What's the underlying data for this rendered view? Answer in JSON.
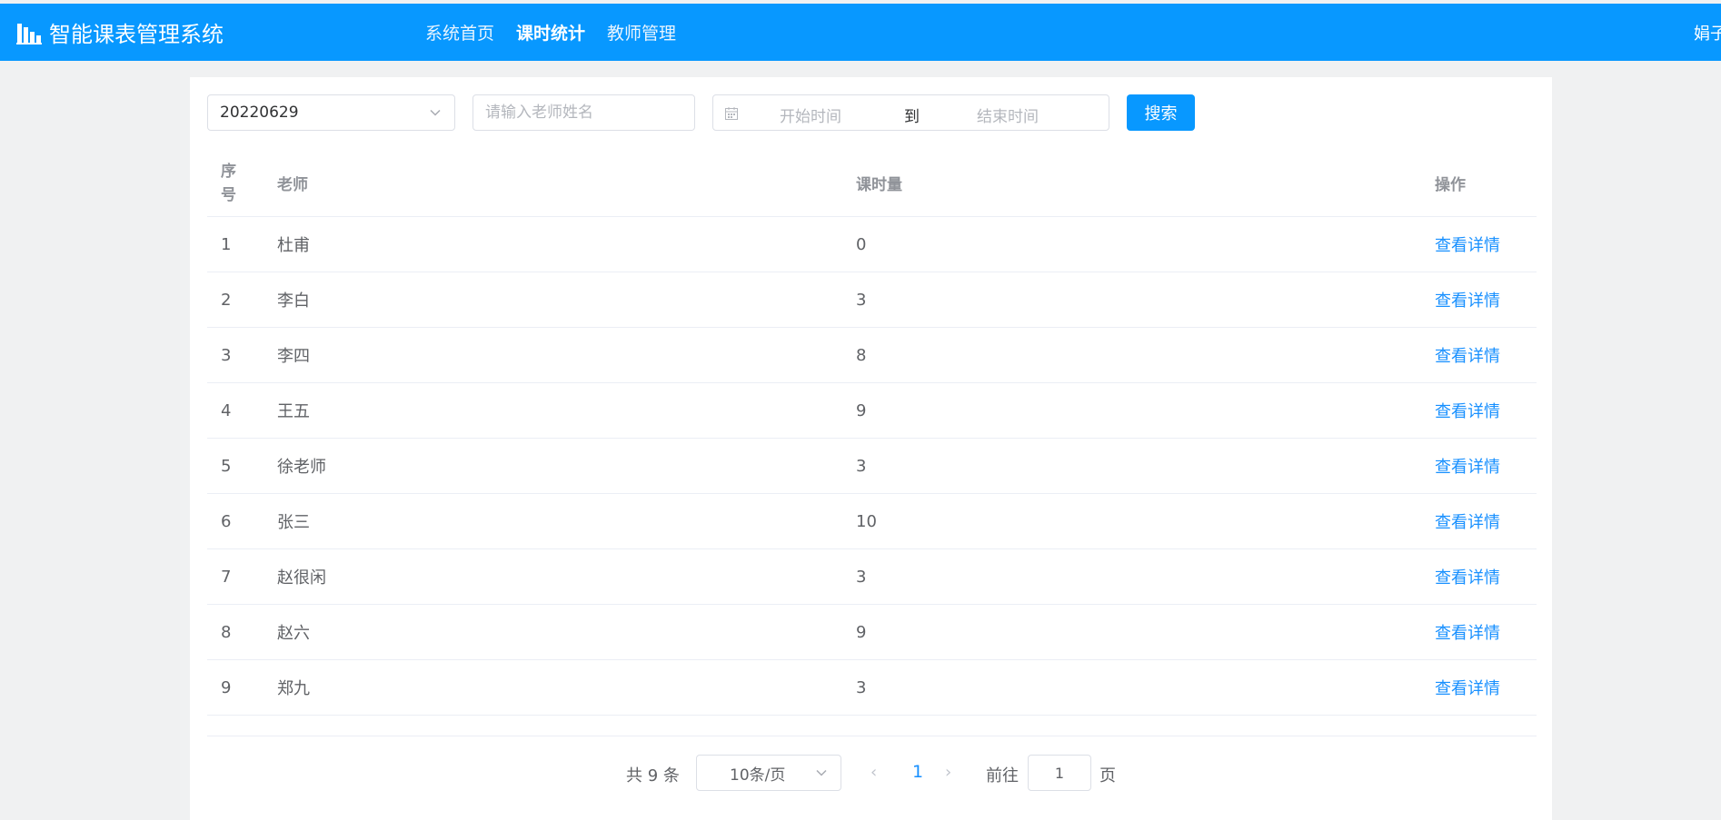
{
  "header": {
    "app_title": "智能课表管理系统",
    "logo_icon": "bar-chart-icon",
    "nav": [
      {
        "label": "系统首页",
        "active": false
      },
      {
        "label": "课时统计",
        "active": true
      },
      {
        "label": "教师管理",
        "active": false
      }
    ],
    "user_name": "娟子",
    "brand_color": "#0898ff"
  },
  "filters": {
    "date_select_value": "20220629",
    "teacher_placeholder": "请输入老师姓名",
    "range_start_placeholder": "开始时间",
    "range_separator": "到",
    "range_end_placeholder": "结束时间",
    "search_label": "搜索"
  },
  "table": {
    "headers": {
      "index_line1": "序",
      "index_line2": "号",
      "teacher": "老师",
      "hours": "课时量",
      "action": "操作"
    },
    "rows": [
      {
        "idx": "1",
        "teacher": "杜甫",
        "hours": "0",
        "action": "查看详情"
      },
      {
        "idx": "2",
        "teacher": "李白",
        "hours": "3",
        "action": "查看详情"
      },
      {
        "idx": "3",
        "teacher": "李四",
        "hours": "8",
        "action": "查看详情"
      },
      {
        "idx": "4",
        "teacher": "王五",
        "hours": "9",
        "action": "查看详情"
      },
      {
        "idx": "5",
        "teacher": "徐老师",
        "hours": "3",
        "action": "查看详情"
      },
      {
        "idx": "6",
        "teacher": "张三",
        "hours": "10",
        "action": "查看详情"
      },
      {
        "idx": "7",
        "teacher": "赵很闲",
        "hours": "3",
        "action": "查看详情"
      },
      {
        "idx": "8",
        "teacher": "赵六",
        "hours": "9",
        "action": "查看详情"
      },
      {
        "idx": "9",
        "teacher": "郑九",
        "hours": "3",
        "action": "查看详情"
      }
    ]
  },
  "pagination": {
    "total_text": "共 9 条",
    "page_size": "10条/页",
    "prev_glyph": "‹",
    "current_page": "1",
    "next_glyph": "›",
    "goto_label": "前往",
    "goto_value": "1",
    "page_unit": "页"
  }
}
